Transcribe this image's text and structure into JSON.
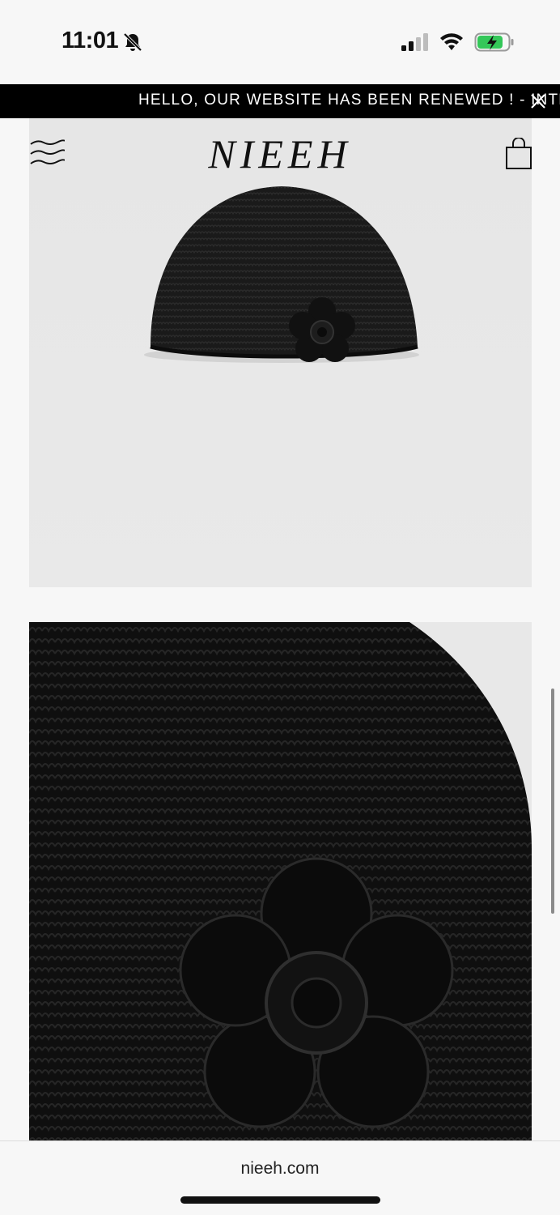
{
  "status_bar": {
    "time": "11:01",
    "icons": [
      "bell-slash-icon",
      "cellular-signal-icon",
      "wifi-icon",
      "battery-charging-icon"
    ],
    "battery_color": "#34c759"
  },
  "announcement": {
    "text": "HELLO, OUR WEBSITE HAS BEEN RENEWED ! - INTERNATIONAL SHIPPING AVAILABLE",
    "close_icon": "close-icon"
  },
  "header": {
    "brand": "NIEEH",
    "menu_icon": "menu-icon",
    "cart_icon": "shopping-bag-icon"
  },
  "gallery": {
    "images": [
      {
        "subject": "black crochet beanie with flower appliqué"
      },
      {
        "subject": "close-up of crochet flower detail"
      }
    ]
  },
  "browser": {
    "url": "nieeh.com"
  }
}
